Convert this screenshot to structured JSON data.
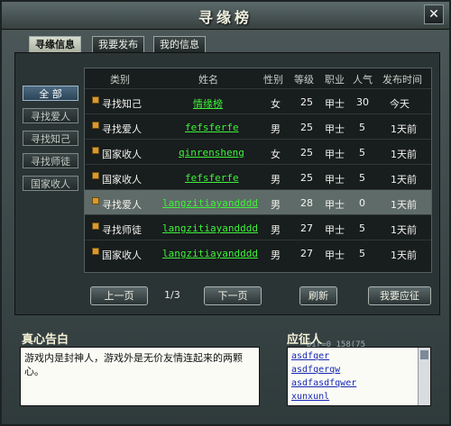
{
  "window": {
    "title": "寻缘榜"
  },
  "tabs": [
    {
      "label": "寻缘信息",
      "active": true
    },
    {
      "label": "我要发布",
      "active": false
    },
    {
      "label": "我的信息",
      "active": false
    }
  ],
  "categories": [
    {
      "label": "全 部",
      "active": true
    },
    {
      "label": "寻找爱人",
      "active": false
    },
    {
      "label": "寻找知己",
      "active": false
    },
    {
      "label": "寻找师徒",
      "active": false
    },
    {
      "label": "国家收人",
      "active": false
    }
  ],
  "table": {
    "headers": [
      "类别",
      "姓名",
      "性别",
      "等级",
      "职业",
      "人气",
      "发布时间"
    ],
    "rows": [
      {
        "type": "寻找知己",
        "name": "情缘榜",
        "gender": "女",
        "level": "25",
        "job": "甲士",
        "popularity": "30",
        "time": "今天",
        "selected": false
      },
      {
        "type": "寻找爱人",
        "name": "fefsferfe",
        "gender": "男",
        "level": "25",
        "job": "甲士",
        "popularity": "5",
        "time": "1天前",
        "selected": false
      },
      {
        "type": "国家收人",
        "name": "qinrensheng",
        "gender": "女",
        "level": "25",
        "job": "甲士",
        "popularity": "5",
        "time": "1天前",
        "selected": false
      },
      {
        "type": "国家收人",
        "name": "fefsferfe",
        "gender": "男",
        "level": "25",
        "job": "甲士",
        "popularity": "5",
        "time": "1天前",
        "selected": false
      },
      {
        "type": "寻找爱人",
        "name": "langzitiayandddd",
        "gender": "男",
        "level": "28",
        "job": "甲士",
        "popularity": "0",
        "time": "1天前",
        "selected": true
      },
      {
        "type": "寻找师徒",
        "name": "langzitiayandddd",
        "gender": "男",
        "level": "27",
        "job": "甲士",
        "popularity": "5",
        "time": "1天前",
        "selected": false
      },
      {
        "type": "国家收人",
        "name": "langzitiayandddd",
        "gender": "男",
        "level": "27",
        "job": "甲士",
        "popularity": "5",
        "time": "1天前",
        "selected": false
      }
    ]
  },
  "pager": {
    "prev_label": "上一页",
    "next_label": "下一页",
    "page": "1/3"
  },
  "actions": {
    "refresh_label": "刷新",
    "apply_label": "我要应征"
  },
  "confession": {
    "title": "真心告白",
    "text": "游戏内是封神人，游戏外是无价友情连起来的两颗心。"
  },
  "responders": {
    "title": "应征人",
    "names": [
      "asdfqer",
      "asdfqerqw",
      "asdfasdfqwer",
      "xunxunl"
    ]
  },
  "overlay": {
    "coords": "Dir=0 158(75"
  }
}
